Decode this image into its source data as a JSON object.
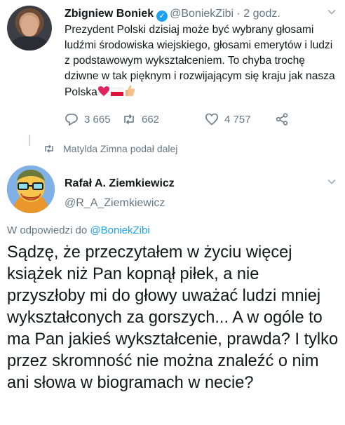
{
  "tweet1": {
    "author_name": "Zbigniew Boniek",
    "handle": "@BoniekZibi",
    "time": "· 2 godz.",
    "text": "Prezydent Polski dzisiaj może być wybrany głosami ludźmi środowiska wiejskiego, głosami emerytów i ludzi z podstawowym wykształceniem. To chyba trochę dziwne w tak pięknym i rozwijającym się kraju jak nasza Polska",
    "emojis": [
      "red-heart",
      "poland-flag",
      "thumbs-up"
    ],
    "reply_count": "3 665",
    "retweet_count": "662",
    "like_count": "4 757"
  },
  "retweet_notice": "Matylda Zimna podał dalej",
  "tweet2": {
    "author_name": "Rafał A. Ziemkiewicz",
    "handle": "@R_A_Ziemkiewicz",
    "replying_prefix": "W odpowiedzi do",
    "replying_handle": "@BoniekZibi",
    "text": "Sądzę, że przeczytałem w życiu więcej książek niż Pan kopnął piłek, a nie przyszłoby mi do głowy uważać ludzi mniej wykształconych za gorszych... A w ogóle to ma Pan jakieś wykształcenie, prawda? I tylko przez skromność nie można znaleźć o nim ani słowa w biogramach w necie?"
  },
  "colors": {
    "accent": "#1da1f2",
    "secondary_text": "#657786",
    "primary_text": "#14171a",
    "divider": "#ccd6dd"
  }
}
